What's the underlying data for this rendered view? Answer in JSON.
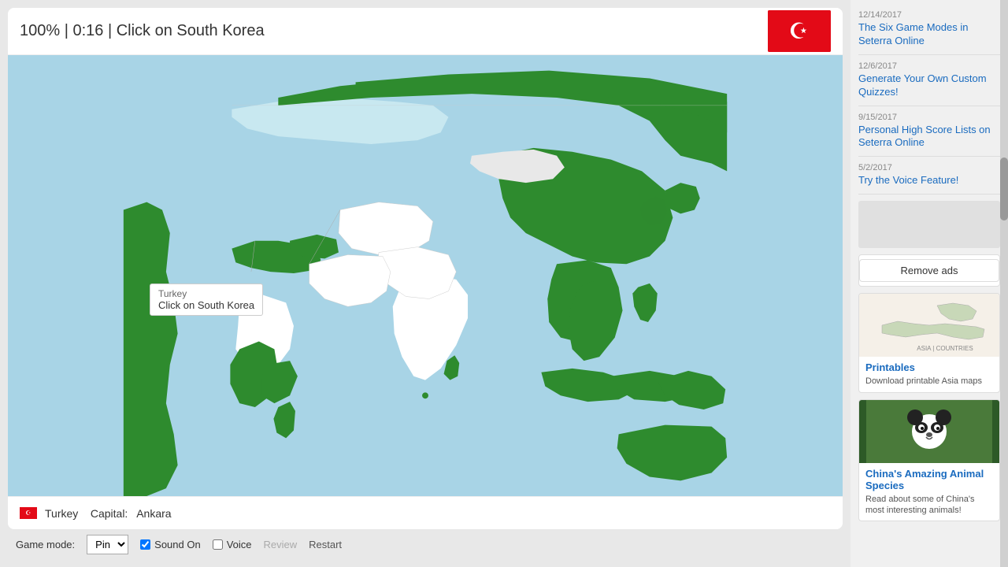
{
  "header": {
    "progress": "100%",
    "timer": "0:16",
    "instruction": "Click on South Korea",
    "title_text": "100% | 0:16 | Click on South Korea"
  },
  "flag": {
    "country": "Turkey",
    "symbol": "☪"
  },
  "tooltip": {
    "country": "Turkey",
    "instruction": "Click on South Korea"
  },
  "footer": {
    "country_name": "Turkey",
    "capital_label": "Capital:",
    "capital": "Ankara"
  },
  "toolbar": {
    "game_mode_label": "Game mode:",
    "game_mode_value": "Pin",
    "sound_on_label": "Sound On",
    "sound_on_checked": true,
    "voice_label": "Voice",
    "voice_checked": false,
    "review_label": "Review",
    "restart_label": "Restart"
  },
  "sidebar": {
    "news_items": [
      {
        "date": "12/14/2017",
        "title": "The Six Game Modes in Seterra Online"
      },
      {
        "date": "12/6/2017",
        "title": "Generate Your Own Custom Quizzes!"
      },
      {
        "date": "9/15/2017",
        "title": "Personal High Score Lists on Seterra Online"
      },
      {
        "date": "5/2/2017",
        "title": "Try the Voice Feature!"
      }
    ],
    "remove_ads_label": "Remove ads",
    "printables_card": {
      "title": "Printables",
      "description": "Download printable Asia maps"
    },
    "panda_card": {
      "title": "China's Amazing Animal Species",
      "description": "Read about some of China's most interesting animals!"
    }
  },
  "colors": {
    "ocean": "#a8d4e6",
    "land_green": "#3a9a3a",
    "land_white": "#f0f0f0",
    "land_light_blue": "#c8e8f0"
  }
}
